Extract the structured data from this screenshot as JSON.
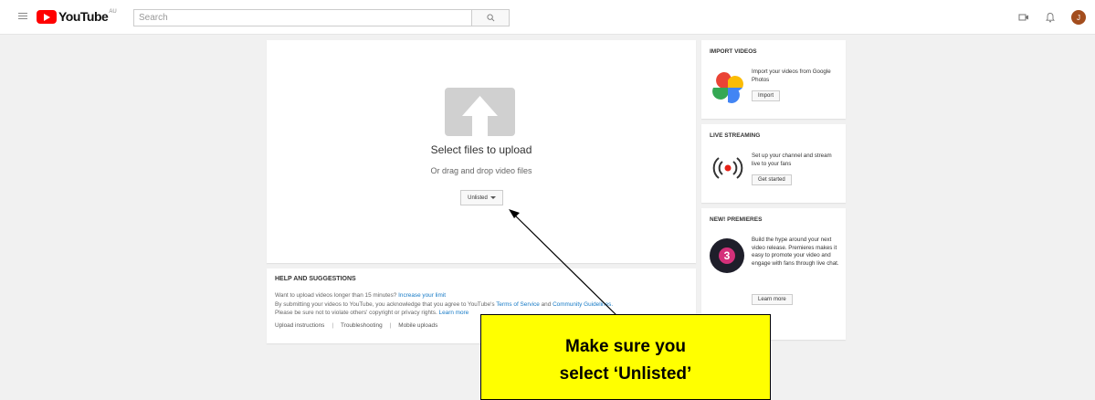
{
  "header": {
    "logo_text": "YouTube",
    "logo_region": "AU",
    "search_placeholder": "Search",
    "avatar_initial": "J"
  },
  "upload": {
    "select_files": "Select files to upload",
    "drag_drop": "Or drag and drop video files",
    "privacy_value": "Unlisted"
  },
  "help": {
    "title": "HELP AND SUGGESTIONS",
    "line1_text": "Want to upload videos longer than 15 minutes?",
    "line1_link": "Increase your limit",
    "line2_text": "By submitting your videos to YouTube, you acknowledge that you agree to YouTube's",
    "line2_link1": "Terms of Service",
    "line2_and": "and",
    "line2_link2": "Community Guidelines.",
    "line3_text": "Please be sure not to violate others' copyright or privacy rights.",
    "line3_link": "Learn more",
    "links": [
      "Upload instructions",
      "Troubleshooting",
      "Mobile uploads"
    ]
  },
  "import_videos": {
    "title": "IMPORT VIDEOS",
    "text": "Import your videos from Google Photos",
    "button": "Import"
  },
  "live_streaming": {
    "title": "LIVE STREAMING",
    "text": "Set up your channel and stream live to your fans",
    "button": "Get started"
  },
  "premieres": {
    "title": "NEW! PREMIERES",
    "badge_number": "3",
    "text": "Build the hype around your next video release. Premieres makes it easy to promote your video and engage with fans through live chat.",
    "button": "Learn more"
  },
  "annotation": {
    "line1": "Make sure you",
    "line2": "select ‘Unlisted’",
    "color": "#ffff00"
  },
  "colors": {
    "brand": "#ff0000",
    "link": "#167ac6",
    "background": "#f1f1f1"
  }
}
